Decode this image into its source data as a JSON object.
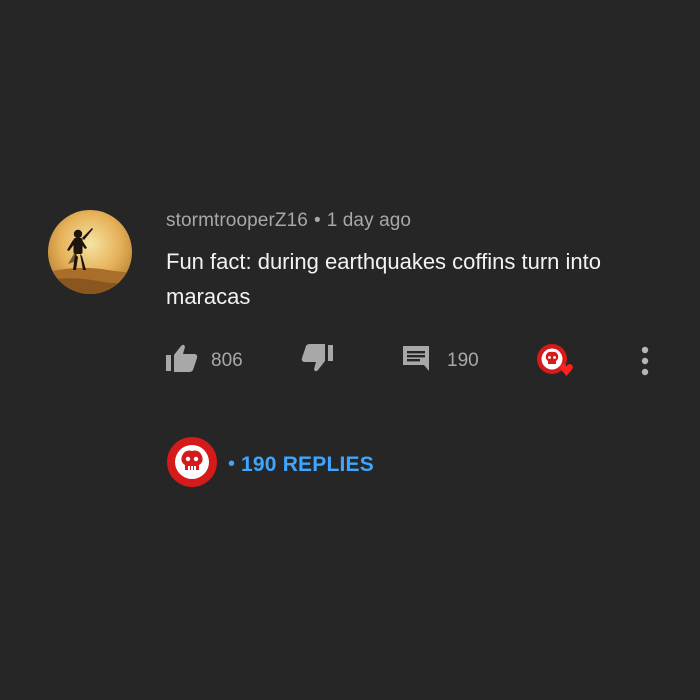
{
  "comment": {
    "author": "stormtrooperZ16",
    "separator": "•",
    "timestamp": "1 day ago",
    "text": "Fun fact: during earthquakes coffins turn into maracas",
    "like_count": "806",
    "reply_count": "190",
    "replies_separator": "•",
    "replies_label": "190 REPLIES"
  },
  "icons": {
    "like": "thumbs-up-icon",
    "dislike": "thumbs-down-icon",
    "reply": "comment-icon",
    "creator_heart": "creator-heart-icon",
    "more": "more-vert-icon"
  },
  "colors": {
    "background": "#262626",
    "accent_blue": "#3ea6ff",
    "heart_red": "#e01818",
    "icon_gray": "#a8a8a8"
  }
}
